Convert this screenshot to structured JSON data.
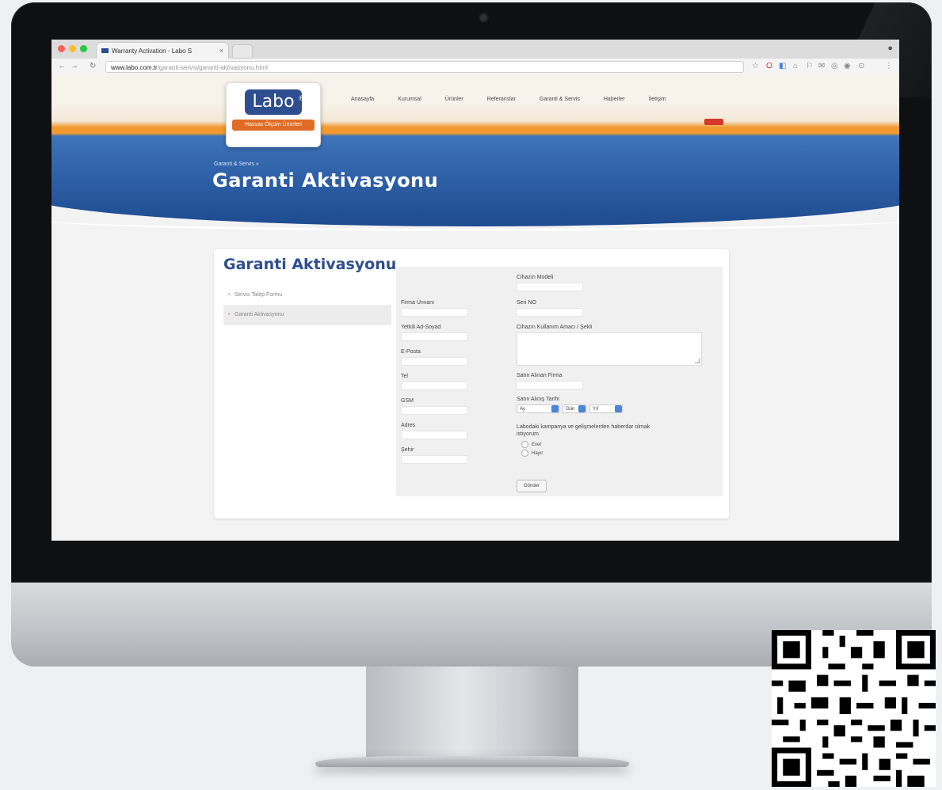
{
  "browser": {
    "tab_title": "Warranty Activation - Labo S",
    "url_host": "www.labo.com.tr",
    "url_path": "/garanti-servis/garanti-aktivasyonu.html"
  },
  "site": {
    "logo": "Labo",
    "logo_tagline": "Hassas Ölçüm Ürünleri",
    "nav": [
      "Anasayfa",
      "Kurumsal",
      "Ürünler",
      "Referanslar",
      "Garanti & Servis",
      "Haberler",
      "İletişim"
    ],
    "breadcrumb": "Garanti & Servis  »",
    "hero_title": "Garanti Aktivasyonu"
  },
  "panel": {
    "title": "Garanti Aktivasyonu",
    "sidenav": [
      "Servis Talep Formu",
      "Garanti Aktivasyonu"
    ]
  },
  "form": {
    "firma_unvani": "Firma Ünvanı",
    "yetkili": "Yetkili Ad-Soyad",
    "eposta": "E-Posta",
    "tel": "Tel",
    "gsm": "GSM",
    "adres": "Adres",
    "sehir": "Şehir",
    "cihaz_model": "Cihazın Modeli",
    "seri_no": "Seri NO",
    "kullanim": "Cihazın Kullanım Amacı / Şekli",
    "satin_alinan_firma": "Satın Alınan Firma",
    "satin_alma_tarihi": "Satın Alınış Tarihi",
    "ay": "Ay",
    "gun": "Gün",
    "yil": "Yıl",
    "kampanya": "Labodaki kampanya ve gelişmelerden haberdar olmak istiyorum",
    "evet": "Evet",
    "hayir": "Hayır",
    "gonder": "Gönder"
  },
  "colors": {
    "brand_blue": "#2e4e8f",
    "accent_orange": "#f59b2c"
  }
}
